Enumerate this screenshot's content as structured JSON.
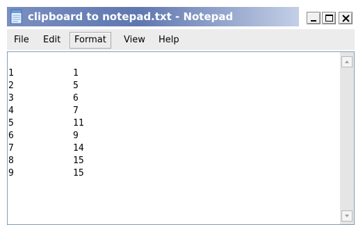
{
  "window": {
    "title": "clipboard to notepad.txt - Notepad",
    "icon": "notepad-icon"
  },
  "controls": {
    "minimize": "minimize-icon",
    "maximize": "maximize-icon",
    "close": "close-icon"
  },
  "menu": {
    "items": [
      {
        "label": "File"
      },
      {
        "label": "Edit"
      },
      {
        "label": "Format"
      },
      {
        "label": "View"
      },
      {
        "label": "Help"
      }
    ],
    "active": "Format"
  },
  "document": {
    "rows": [
      {
        "a": "1",
        "b": "1"
      },
      {
        "a": "2",
        "b": "5"
      },
      {
        "a": "3",
        "b": "6"
      },
      {
        "a": "4",
        "b": "7"
      },
      {
        "a": "5",
        "b": "11"
      },
      {
        "a": "6",
        "b": "9"
      },
      {
        "a": "7",
        "b": "14"
      },
      {
        "a": "8",
        "b": "15"
      },
      {
        "a": "9",
        "b": "15"
      }
    ]
  },
  "colors": {
    "title_start": "#7a8fc0",
    "title_end": "#c4cfe6",
    "menubar": "#ececec"
  }
}
